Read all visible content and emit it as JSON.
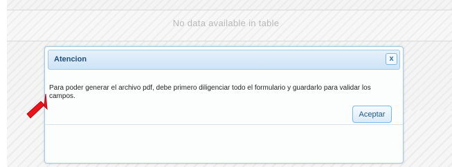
{
  "table": {
    "empty_message": "No data available in table"
  },
  "dialog": {
    "title": "Atencion",
    "close_icon": "close-icon",
    "close_label": "x",
    "message": "Para poder generar el archivo pdf, debe primero diligenciar todo el formulario y guardarlo para validar los campos.",
    "accept_label": "Aceptar"
  },
  "annotation": {
    "arrow_icon": "red-arrow-icon",
    "arrow_color": "#e8131b"
  },
  "colors": {
    "title_text": "#1d4f7a",
    "dialog_border": "#a6c9e2",
    "button_text": "#1d5987"
  }
}
